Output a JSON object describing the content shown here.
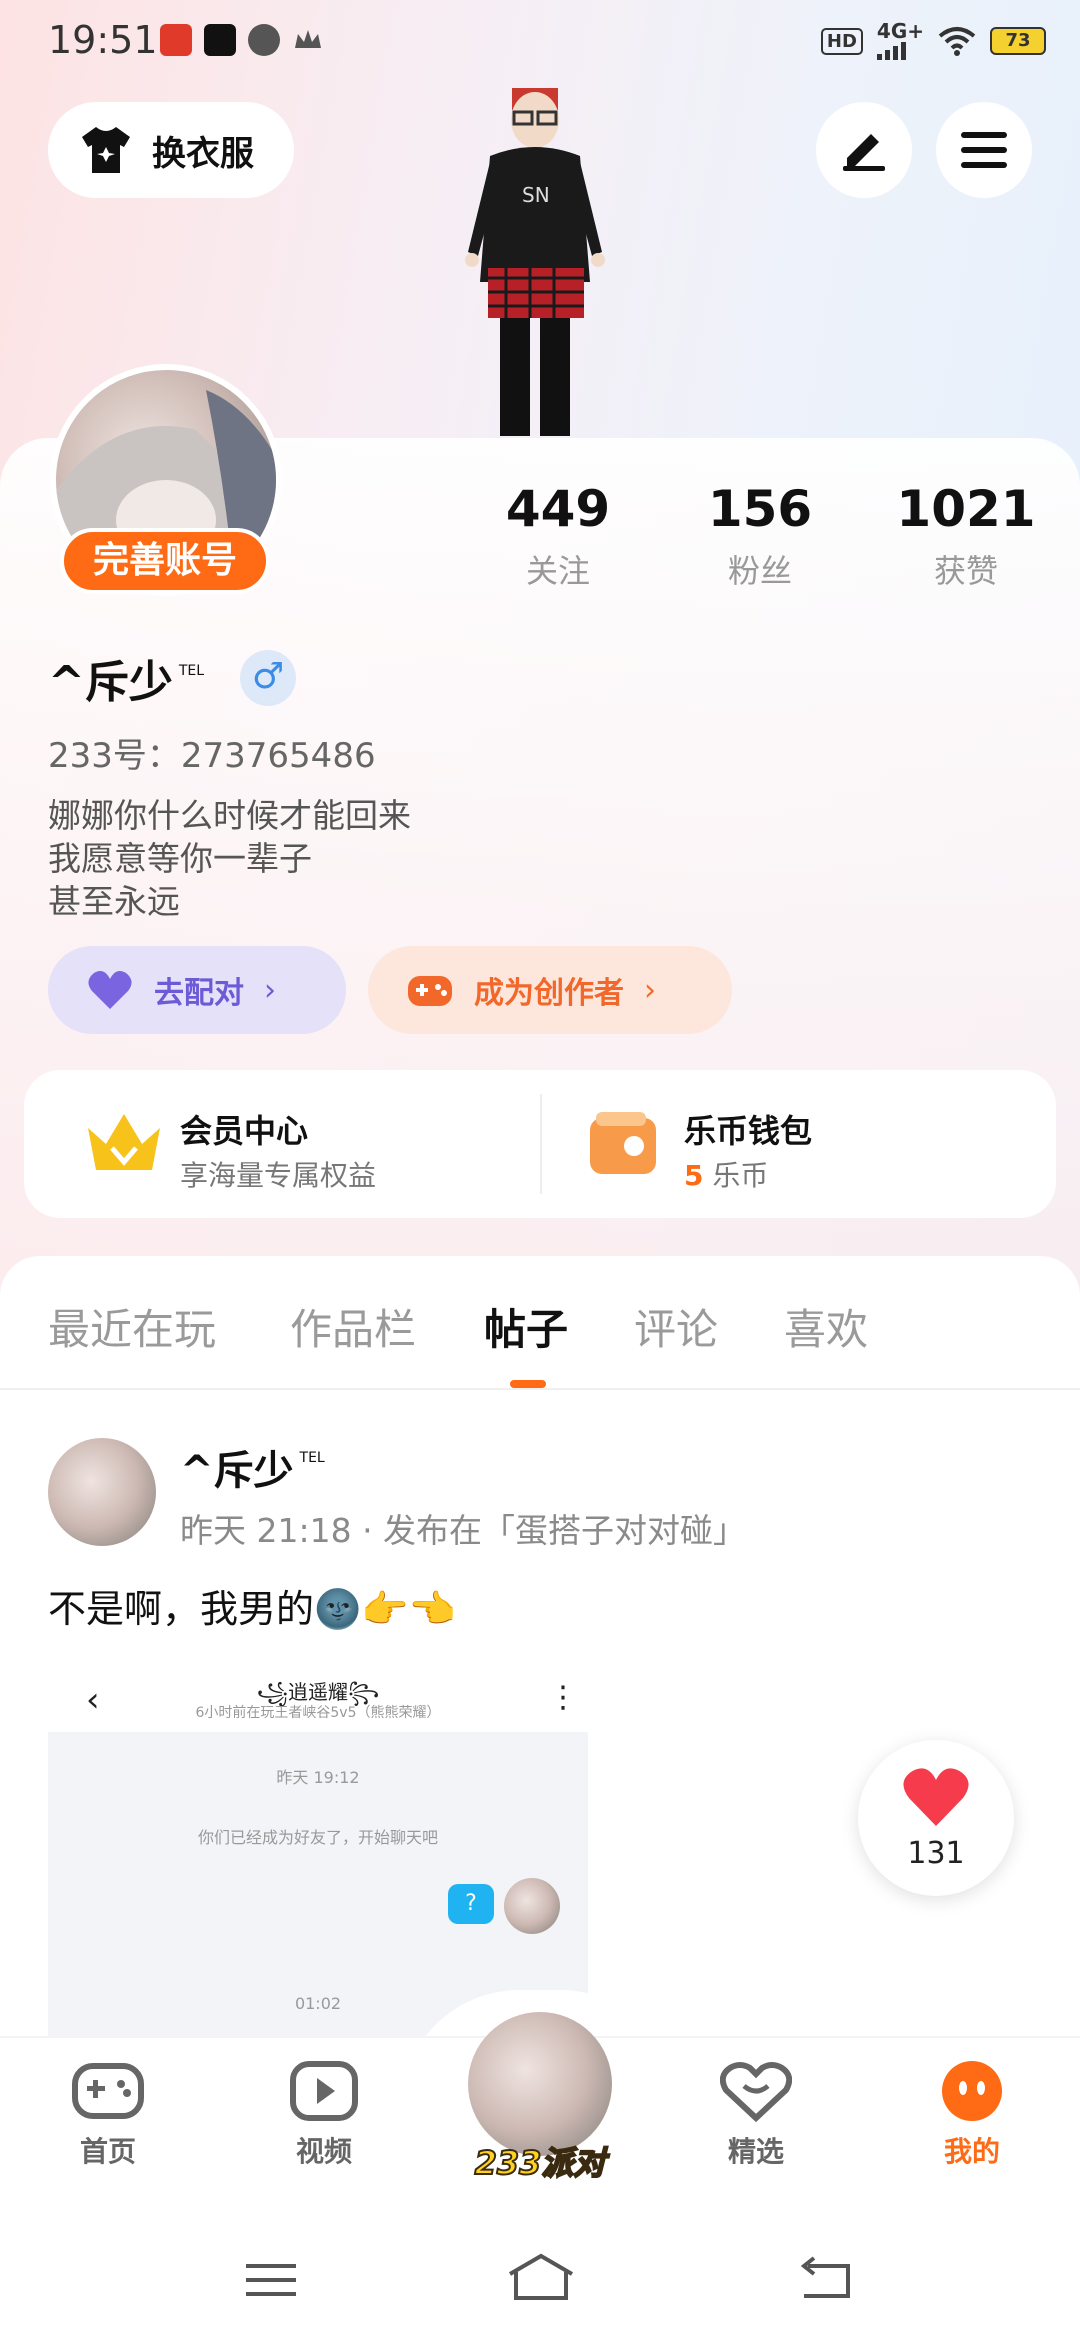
{
  "status_bar": {
    "time": "19:51",
    "hd": "HD",
    "network": "4G+",
    "battery": "73"
  },
  "top": {
    "outfit_label": "换衣服",
    "edit_icon": "pencil-icon",
    "menu_icon": "menu-icon"
  },
  "profile": {
    "complete_label": "完善账号",
    "stats": [
      {
        "value": "449",
        "label": "关注"
      },
      {
        "value": "156",
        "label": "粉丝"
      },
      {
        "value": "1021",
        "label": "获赞"
      }
    ],
    "username": "^斥少",
    "username_tag": "TEL",
    "gender_symbol": "♂",
    "uid": "233号：273765486",
    "bio": [
      "娜娜你什么时候才能回来",
      "我愿意等你一辈子",
      "甚至永远"
    ],
    "match_label": "去配对",
    "creator_label": "成为创作者",
    "vip": {
      "title": "会员中心",
      "subtitle": "享海量专属权益"
    },
    "wallet": {
      "title": "乐币钱包",
      "amount": "5",
      "unit": "乐币"
    }
  },
  "tabs": [
    "最近在玩",
    "作品栏",
    "帖子",
    "评论",
    "喜欢"
  ],
  "active_tab": "帖子",
  "post": {
    "user": "^斥少",
    "user_tag": "TEL",
    "meta": "昨天 21:18 · 发布在「蛋搭子对对碰」",
    "text": "不是啊，我男的🌚👉👈",
    "screenshot": {
      "back": "‹",
      "title": "꧁逍遥耀꧂",
      "subtitle": "6小时前在玩王者峡谷5v5（熊熊荣耀）",
      "more": "⋮",
      "time1": "昨天 19:12",
      "notice": "你们已经成为好友了，开始聊天吧",
      "bubble": "?",
      "time2": "01:02"
    },
    "likes": "131"
  },
  "bottom_nav": [
    {
      "label": "首页",
      "icon": "gamepad-icon"
    },
    {
      "label": "视频",
      "icon": "video-icon"
    },
    {
      "label": "233派对",
      "icon": "party-avatar"
    },
    {
      "label": "精选",
      "icon": "heart-chat-icon"
    },
    {
      "label": "我的",
      "icon": "me-icon"
    }
  ],
  "colors": {
    "accent": "#ff6a14",
    "match": "#6b5bd6",
    "creator": "#f2682a"
  }
}
